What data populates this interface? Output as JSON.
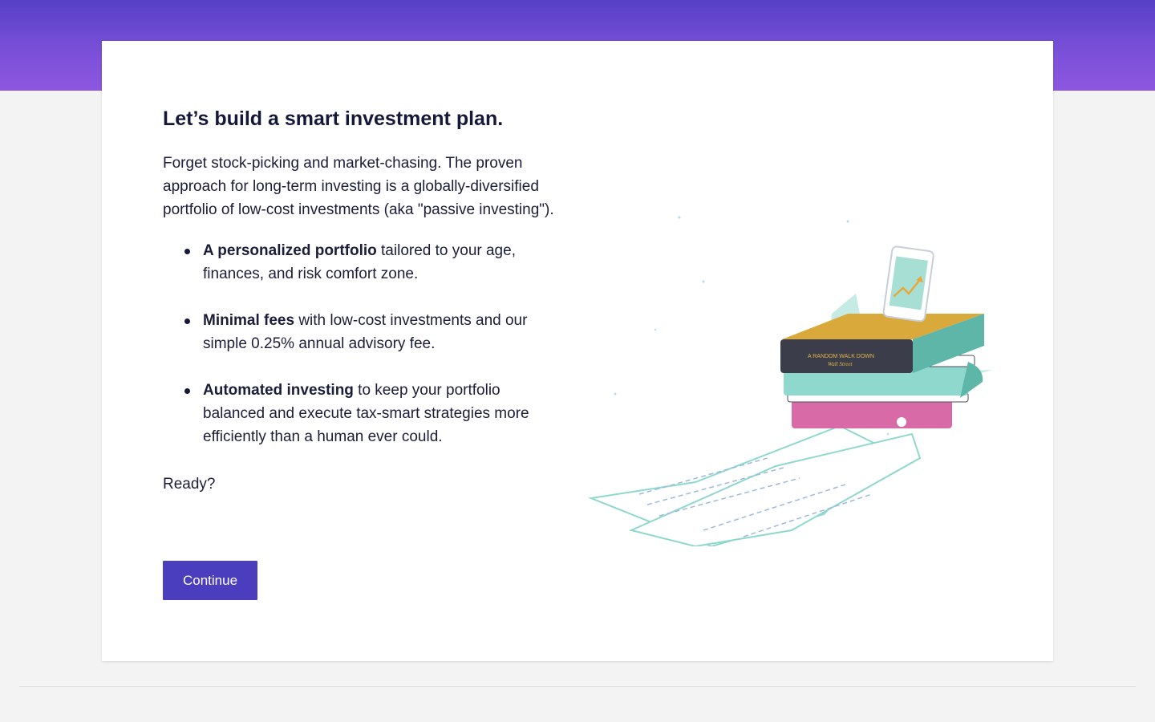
{
  "colors": {
    "accent": "#4a3ebf",
    "header_gradient_start": "#5540c6",
    "header_gradient_end": "#8d57e0",
    "text": "#16183a"
  },
  "main": {
    "title": "Let’s build a smart investment plan.",
    "intro": "Forget stock-picking and market-chasing. The proven approach for long-term investing is a globally-diversified portfolio of low-cost investments (aka \"passive investing\").",
    "features": [
      {
        "bold": "A personalized portfolio",
        "rest": " tailored to your age, finances, and risk comfort zone."
      },
      {
        "bold": "Minimal fees",
        "rest": " with low-cost investments and our simple 0.25% annual advisory fee."
      },
      {
        "bold": "Automated investing",
        "rest": " to keep your portfolio balanced and execute tax-smart strategies more efficiently than a human ever could."
      }
    ],
    "ready": "Ready?",
    "continue_label": "Continue"
  },
  "illustration": {
    "book_spine_text": "A RANDOM WALK DOWN",
    "book_spine_subtext": "Wall Street",
    "icon": "books-phone-chart-illustration"
  }
}
